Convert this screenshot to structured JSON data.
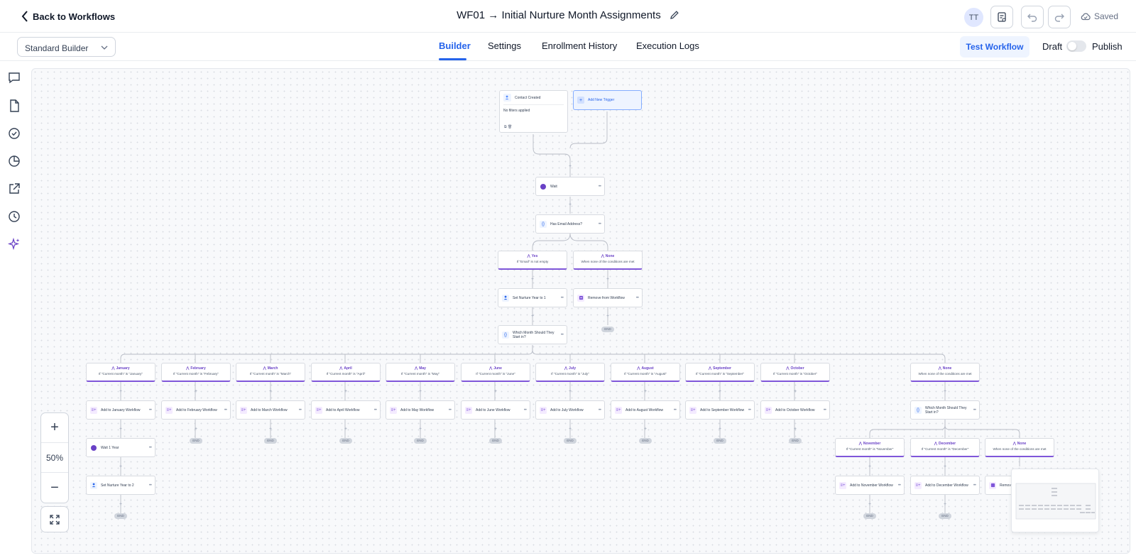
{
  "header": {
    "back_label": "Back to Workflows",
    "title": "WF01 → Initial Nurture Month Assignments",
    "avatar_initials": "TT",
    "saved_label": "Saved"
  },
  "subbar": {
    "builder_select": "Standard Builder",
    "tabs": [
      "Builder",
      "Settings",
      "Enrollment History",
      "Execution Logs"
    ],
    "active_tab": "Builder",
    "test_button": "Test Workflow",
    "draft_label": "Draft",
    "publish_label": "Publish"
  },
  "zoom": {
    "level": "50%",
    "in": "+",
    "out": "−"
  },
  "flow": {
    "trigger": {
      "label": "Contact Created",
      "sub": "No filters applied"
    },
    "add_trigger": "Add New Trigger",
    "wait": "Wait",
    "has_email": "Has Email Address?",
    "yes_branch": {
      "title": "Yes",
      "cond": "If \"Email\" is not empty"
    },
    "none_branch_1": {
      "title": "None",
      "cond": "When none of the conditions are met"
    },
    "set_nurture_1": "Set Nurture Year to 1",
    "remove_workflow": "Remove from Workflow",
    "which_month": "Which Month Should They Start in?",
    "months": [
      {
        "title": "January",
        "cond": "If \"Current month\" is \"January\"",
        "action": "Add to January Workflow"
      },
      {
        "title": "February",
        "cond": "If \"Current month\" is \"February\"",
        "action": "Add to February Workflow"
      },
      {
        "title": "March",
        "cond": "If \"Current month\" is \"March\"",
        "action": "Add to March Workflow"
      },
      {
        "title": "April",
        "cond": "If \"Current month\" is \"April\"",
        "action": "Add to April Workflow"
      },
      {
        "title": "May",
        "cond": "If \"Current month\" is \"May\"",
        "action": "Add to May Workflow"
      },
      {
        "title": "June",
        "cond": "If \"Current month\" is \"June\"",
        "action": "Add to June Workflow"
      },
      {
        "title": "July",
        "cond": "If \"Current month\" is \"July\"",
        "action": "Add to July Workflow"
      },
      {
        "title": "August",
        "cond": "If \"Current month\" is \"August\"",
        "action": "Add to August Workflow"
      },
      {
        "title": "September",
        "cond": "If \"Current month\" is \"September\"",
        "action": "Add to September Workflow"
      },
      {
        "title": "October",
        "cond": "If \"Current month\" is \"October\"",
        "action": "Add to October Workflow"
      }
    ],
    "none_branch_2": {
      "title": "None",
      "cond": "When none of the conditions are met"
    },
    "which_month_2": "Which Month Should They Start in?",
    "late_months": [
      {
        "title": "November",
        "cond": "If \"Current month\" is \"November\"",
        "action": "Add to November Workflow"
      },
      {
        "title": "December",
        "cond": "If \"Current month\" is \"December\"",
        "action": "Add to December Workflow"
      }
    ],
    "none_branch_3": {
      "title": "None",
      "cond": "When none of the conditions are met",
      "action": "Remov"
    },
    "wait_1_year": "Wait 1 Year",
    "set_nurture_2": "Set Nurture Year to 2",
    "end_label": "END"
  },
  "colors": {
    "accent": "#2563eb",
    "purple": "#7f56d9",
    "canvas": "#f8f9fb"
  },
  "icons": [
    "chevron-left-icon",
    "pencil-icon",
    "clipboard-icon",
    "undo-icon",
    "redo-icon",
    "cloud-icon",
    "chat-icon",
    "document-icon",
    "check-circle-icon",
    "pie-chart-icon",
    "external-link-icon",
    "history-icon",
    "sparkle-icon",
    "expand-icon"
  ]
}
